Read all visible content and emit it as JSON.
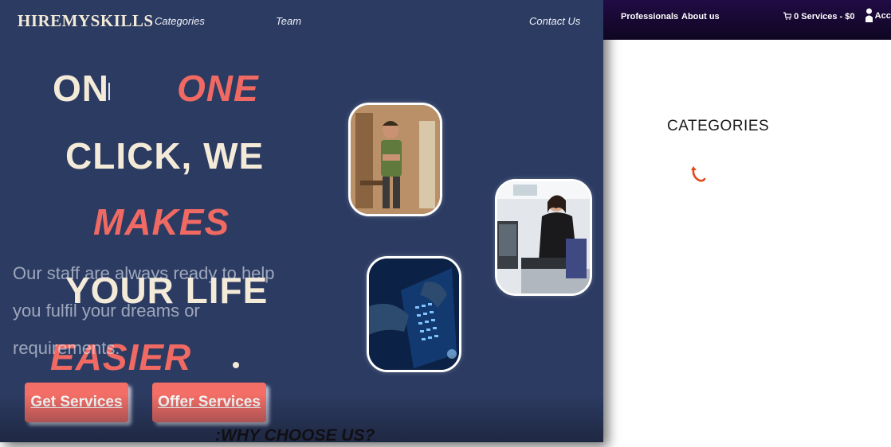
{
  "brand": "HIREMYSKILLS",
  "nav": {
    "categories": "Categories",
    "team": "Team",
    "contact": "Contact Us"
  },
  "top_bar": {
    "professionals": "Professionals",
    "about": "About us",
    "cart": "0 Services - $0",
    "account": "Accou"
  },
  "hero": {
    "words": [
      "ON",
      "ONE",
      "CLICK, WE",
      "MAKES",
      "YOUR LIFE",
      "EASIER"
    ],
    "description": "Our staff are always ready to help you fulfil your dreams or requirements."
  },
  "buttons": {
    "get_services": "Get Services",
    "offer_services": "Offer Services"
  },
  "why_heading": "WHY CHOOSE US?",
  "categories_title": "CATEGORIES",
  "colors": {
    "hero_bg": "#2c3b62",
    "accent": "#f06a63",
    "cream": "#f4ead8",
    "top_bar": "#1a0836"
  }
}
